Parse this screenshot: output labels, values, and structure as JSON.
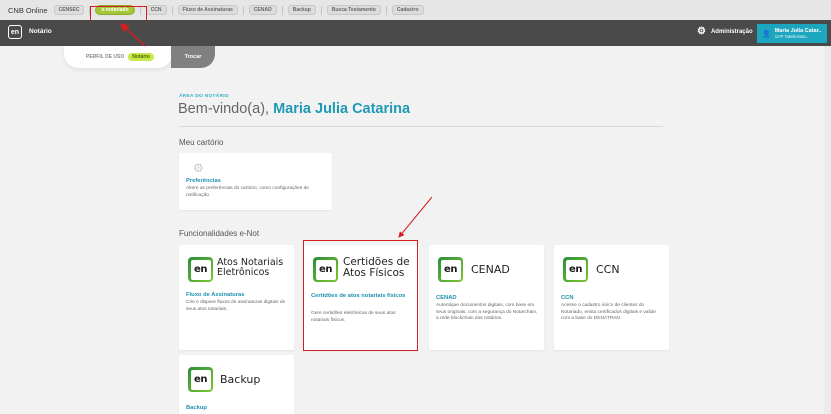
{
  "topbar": {
    "brand": "CNB Online",
    "tabs": [
      "CENSEC",
      "e-notariado",
      "CCN",
      "Fluxo de Assinaturas",
      "CENAD",
      "Backup",
      "Busca Testamento",
      "Cadastro"
    ]
  },
  "navbar": {
    "logo": "en",
    "title": "Notário",
    "admin_label": "Administração",
    "user_name": "Maria Julia Catar..",
    "user_sub": "11ºP Tabelionato..."
  },
  "profile": {
    "label": "PERFIL DE USO",
    "value": "Notário",
    "switch_label": "Trocar"
  },
  "welcome": {
    "area_label": "ÁREA DO NOTÁRIO",
    "greeting": "Bem-vindo(a),",
    "name": "Maria Julia Catarina"
  },
  "my_office": {
    "section_title": "Meu cartório",
    "preferences": {
      "title": "Preferências",
      "description": "Altere as preferências do cartório, como configurações de notificação"
    }
  },
  "features": {
    "section_title": "Funcionalidades e-Not",
    "cards": [
      {
        "logo_line1": "Atos Notariais",
        "logo_line2": "Eletrônicos",
        "title": "Fluxo de Assinaturas",
        "description": "Crie e dispare fluxos de assinaturas digitais de seus atos notariais."
      },
      {
        "logo_line1": "Certidões de",
        "logo_line2": "Atos Físicos",
        "title": "Certidões de atos notariais físicos",
        "description": "Gere certidões eletrônicas de seus atos notariais físicos."
      },
      {
        "logo_line1": "CENAD",
        "title": "CENAD",
        "description": "Autentique documentos digitais, com base em seus originais, com a segurança do Notarchain, a rede blockchain dos notários."
      },
      {
        "logo_line1": "CCN",
        "title": "CCN",
        "description": "Acesse o cadastro único de clientes do Notariado, emita certificados digitais e valide com a base do DENATRAN."
      },
      {
        "logo_line1": "Backup",
        "title": "Backup"
      }
    ],
    "badge_text": "en"
  },
  "colors": {
    "accent": "#1e9ab5",
    "highlight": "#d21f1f",
    "brand_green": "#a6c63a",
    "navbar": "#4a4a4a"
  }
}
